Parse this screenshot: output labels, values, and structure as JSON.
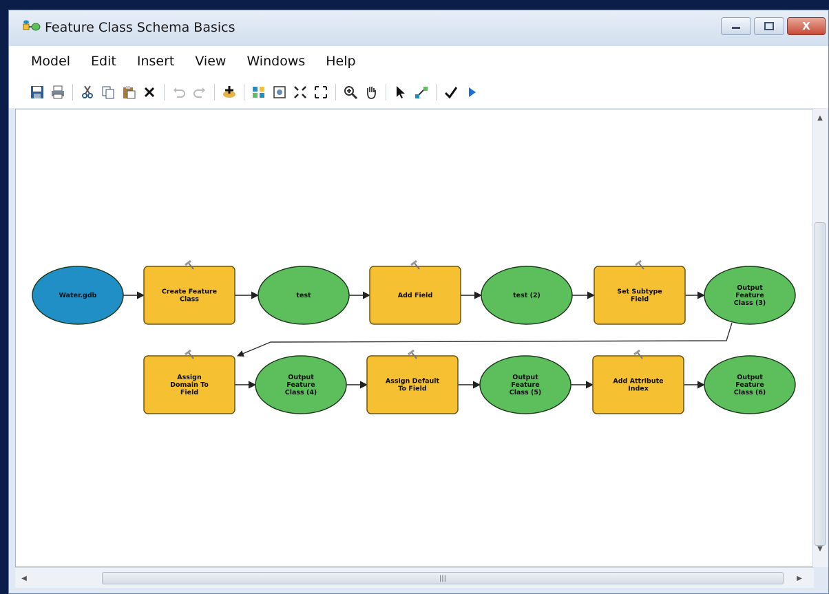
{
  "window": {
    "title": "Feature Class Schema Basics",
    "controls": {
      "minimize": "–",
      "maximize": "□",
      "close": "X"
    }
  },
  "menu": [
    "Model",
    "Edit",
    "Insert",
    "View",
    "Windows",
    "Help"
  ],
  "toolbar": [
    "save-icon",
    "print-icon",
    "cut-icon",
    "copy-icon",
    "paste-icon",
    "delete-icon",
    "undo-icon",
    "redo-icon",
    "add-data-icon",
    "auto-layout-icon",
    "full-extent-icon",
    "zoom-fixed-in-icon",
    "zoom-fixed-out-icon",
    "zoom-in-icon",
    "pan-icon",
    "select-icon",
    "connect-icon",
    "validate-icon",
    "run-icon"
  ],
  "diagram": {
    "row1": [
      {
        "type": "input",
        "label": [
          "Water.gdb"
        ]
      },
      {
        "type": "tool",
        "label": [
          "Create Feature",
          "Class"
        ]
      },
      {
        "type": "output",
        "label": [
          "test"
        ]
      },
      {
        "type": "tool",
        "label": [
          "Add Field"
        ]
      },
      {
        "type": "output",
        "label": [
          "test (2)"
        ]
      },
      {
        "type": "tool",
        "label": [
          "Set Subtype",
          "Field"
        ]
      },
      {
        "type": "output",
        "label": [
          "Output",
          "Feature",
          "Class (3)"
        ]
      }
    ],
    "row2": [
      {
        "type": "tool",
        "label": [
          "Assign",
          "Domain To",
          "Field"
        ]
      },
      {
        "type": "output",
        "label": [
          "Output",
          "Feature",
          "Class (4)"
        ]
      },
      {
        "type": "tool",
        "label": [
          "Assign Default",
          "To Field"
        ]
      },
      {
        "type": "output",
        "label": [
          "Output",
          "Feature",
          "Class (5)"
        ]
      },
      {
        "type": "tool",
        "label": [
          "Add Attribute",
          "Index"
        ]
      },
      {
        "type": "output",
        "label": [
          "Output",
          "Feature",
          "Class (6)"
        ]
      }
    ]
  },
  "colors": {
    "input": "#1f8fc6",
    "tool": "#f5c132",
    "output": "#5cbf5c",
    "title_bg": "#dfe8f3"
  }
}
